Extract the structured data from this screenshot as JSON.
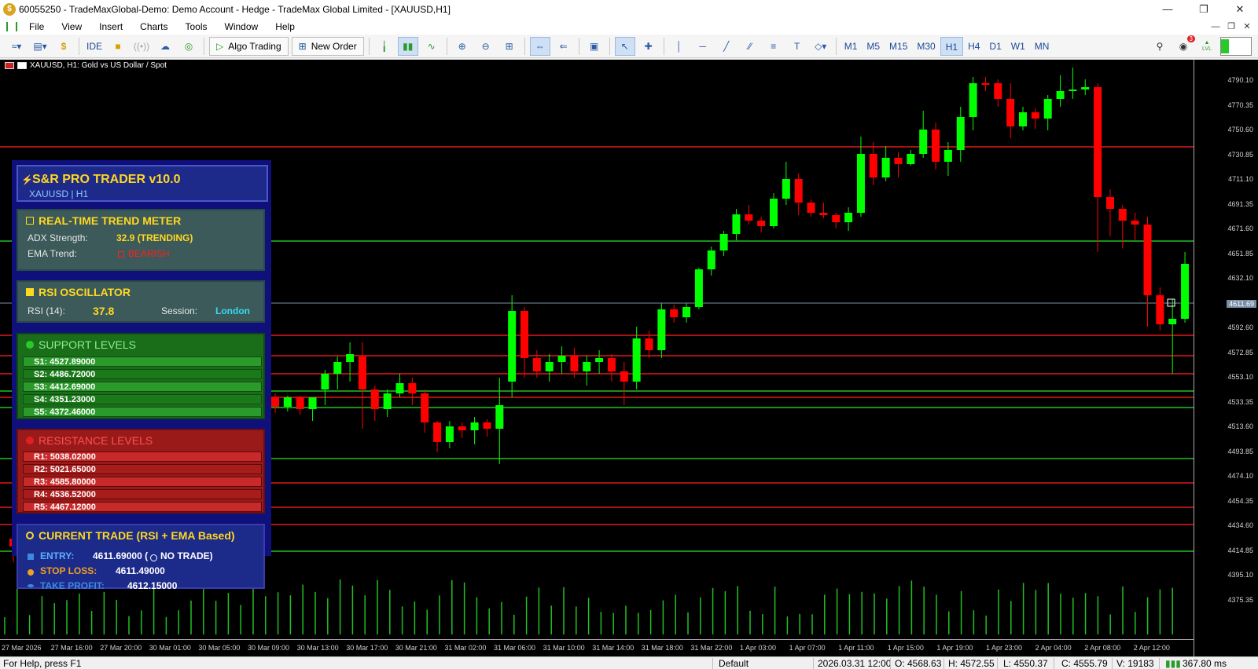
{
  "window": {
    "title": "60055250 - TradeMaxGlobal-Demo: Demo Account - Hedge - TradeMax Global Limited - [XAUUSD,H1]"
  },
  "menu": [
    "File",
    "View",
    "Insert",
    "Charts",
    "Tools",
    "Window",
    "Help"
  ],
  "toolbar": {
    "ide": "IDE",
    "algo_trading": "Algo Trading",
    "new_order": "New Order",
    "timeframes": [
      "M1",
      "M5",
      "M15",
      "M30",
      "H1",
      "H4",
      "D1",
      "W1",
      "MN"
    ],
    "active_timeframe": "H1",
    "notification_count": "3",
    "lvl_label": "LVL"
  },
  "chart": {
    "header": "XAUUSD, H1:  Gold vs US Dollar / Spot",
    "current_price": "4611.69",
    "price_ticks": [
      "4790.10",
      "4770.35",
      "4750.60",
      "4730.85",
      "4711.10",
      "4691.35",
      "4671.60",
      "4651.85",
      "4632.10",
      "4592.60",
      "4572.85",
      "4553.10",
      "4533.35",
      "4513.60",
      "4493.85",
      "4474.10",
      "4454.35",
      "4434.60",
      "4414.85",
      "4395.10",
      "4375.35"
    ],
    "time_ticks": [
      "27 Mar 2026",
      "27 Mar 16:00",
      "27 Mar 20:00",
      "30 Mar 01:00",
      "30 Mar 05:00",
      "30 Mar 09:00",
      "30 Mar 13:00",
      "30 Mar 17:00",
      "30 Mar 21:00",
      "31 Mar 02:00",
      "31 Mar 06:00",
      "31 Mar 10:00",
      "31 Mar 14:00",
      "31 Mar 18:00",
      "31 Mar 22:00",
      "1 Apr 03:00",
      "1 Apr 07:00",
      "1 Apr 11:00",
      "1 Apr 15:00",
      "1 Apr 19:00",
      "1 Apr 23:00",
      "2 Apr 04:00",
      "2 Apr 08:00",
      "2 Apr 12:00"
    ],
    "colors": {
      "bull": "#00ff00",
      "bear": "#ff0000",
      "background": "#000000"
    }
  },
  "panel": {
    "title": "S&R PRO TRADER v10.0",
    "subtitle": "XAUUSD | H1",
    "trend": {
      "title": "REAL-TIME TREND METER",
      "adx_label": "ADX Strength:",
      "adx_value": "32.9 (TRENDING)",
      "ema_label": "EMA Trend:",
      "ema_value": "BEARISH"
    },
    "rsi": {
      "title": "RSI OSCILLATOR",
      "rsi_label": "RSI (14):",
      "rsi_value": "37.8",
      "session_label": "Session:",
      "session_value": "London"
    },
    "support": {
      "title": "SUPPORT LEVELS",
      "levels": [
        "S1: 4527.89000",
        "S2: 4486.72000",
        "S3: 4412.69000",
        "S4: 4351.23000",
        "S5: 4372.46000"
      ]
    },
    "resistance": {
      "title": "RESISTANCE LEVELS",
      "levels": [
        "R1: 5038.02000",
        "R2: 5021.65000",
        "R3: 4585.80000",
        "R4: 4536.52000",
        "R5: 4467.12000"
      ]
    },
    "trade": {
      "title": "CURRENT TRADE (RSI + EMA Based)",
      "entry_label": "ENTRY:",
      "entry_value": "4611.69000 (",
      "no_trade": "NO TRADE)",
      "sl_label": "STOP LOSS:",
      "sl_value": "4611.49000",
      "tp_label": "TAKE PROFIT:",
      "tp_value": "4612.15000"
    }
  },
  "status": {
    "help": "For Help, press F1",
    "profile": "Default",
    "datetime": "2026.03.31 12:00",
    "open": "O: 4568.63",
    "high": "H: 4572.55",
    "low": "L: 4550.37",
    "close": "C: 4555.79",
    "volume": "V: 19183",
    "ping": "367.80 ms"
  }
}
